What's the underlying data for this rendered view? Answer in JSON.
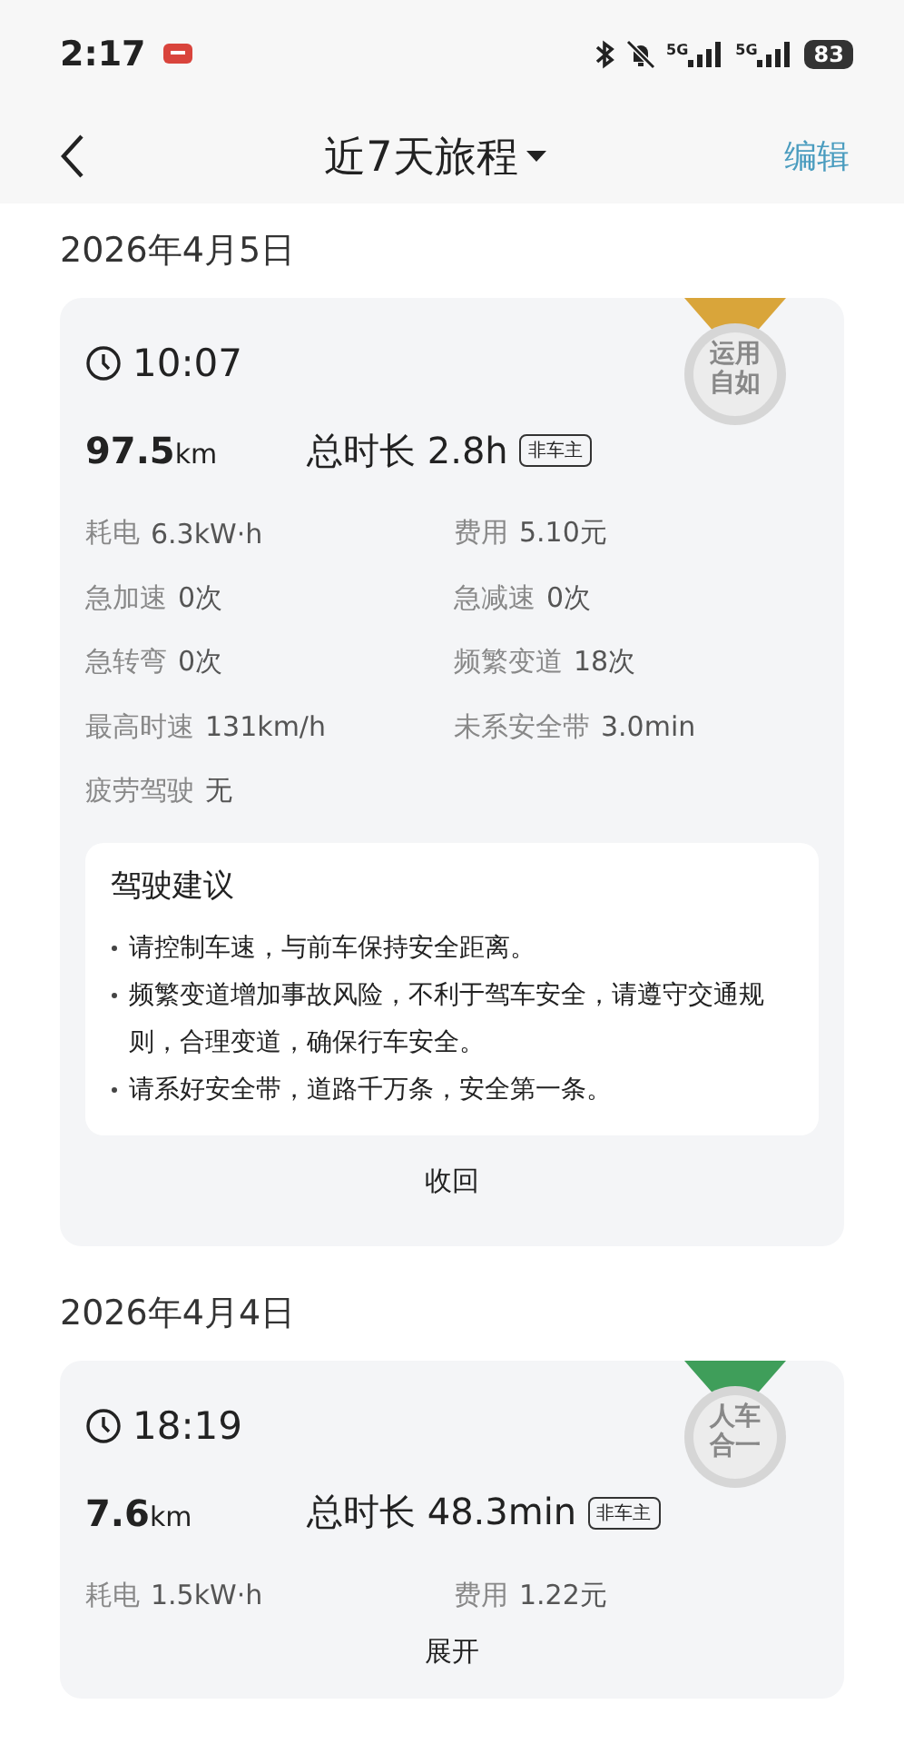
{
  "status_bar": {
    "time": "2:17",
    "network_1": "5G",
    "network_2": "5G",
    "battery": "83"
  },
  "header": {
    "title": "近7天旅程",
    "action": "编辑"
  },
  "trips": [
    {
      "date": "2026年4月5日",
      "time": "10:07",
      "distance": "97.5",
      "distance_unit": "km",
      "duration": "总时长 2.8h",
      "tag": "非车主",
      "medal": {
        "lines": [
          "运用",
          "自如"
        ],
        "color": "#d9a53a"
      },
      "stats": [
        {
          "label": "耗电",
          "value": "6.3kW·h"
        },
        {
          "label": "费用",
          "value": "5.10元"
        },
        {
          "label": "急加速",
          "value": "0次"
        },
        {
          "label": "急减速",
          "value": "0次"
        },
        {
          "label": "急转弯",
          "value": "0次"
        },
        {
          "label": "频繁变道",
          "value": "18次"
        },
        {
          "label": "最高时速",
          "value": "131km/h"
        },
        {
          "label": "未系安全带",
          "value": "3.0min"
        },
        {
          "label": "疲劳驾驶",
          "value": "无"
        }
      ],
      "advice": {
        "title": "驾驶建议",
        "items": [
          "请控制车速，与前车保持安全距离。",
          "频繁变道增加事故风险，不利于驾车安全，请遵守交通规则，合理变道，确保行车安全。",
          "请系好安全带，道路千万条，安全第一条。"
        ]
      },
      "toggle": "收回"
    },
    {
      "date": "2026年4月4日",
      "time": "18:19",
      "distance": "7.6",
      "distance_unit": "km",
      "duration": "总时长 48.3min",
      "tag": "非车主",
      "medal": {
        "lines": [
          "人车",
          "合一"
        ],
        "color": "#3f9e5a"
      },
      "stats": [
        {
          "label": "耗电",
          "value": "1.5kW·h"
        },
        {
          "label": "费用",
          "value": "1.22元"
        }
      ],
      "toggle": "展开"
    }
  ]
}
